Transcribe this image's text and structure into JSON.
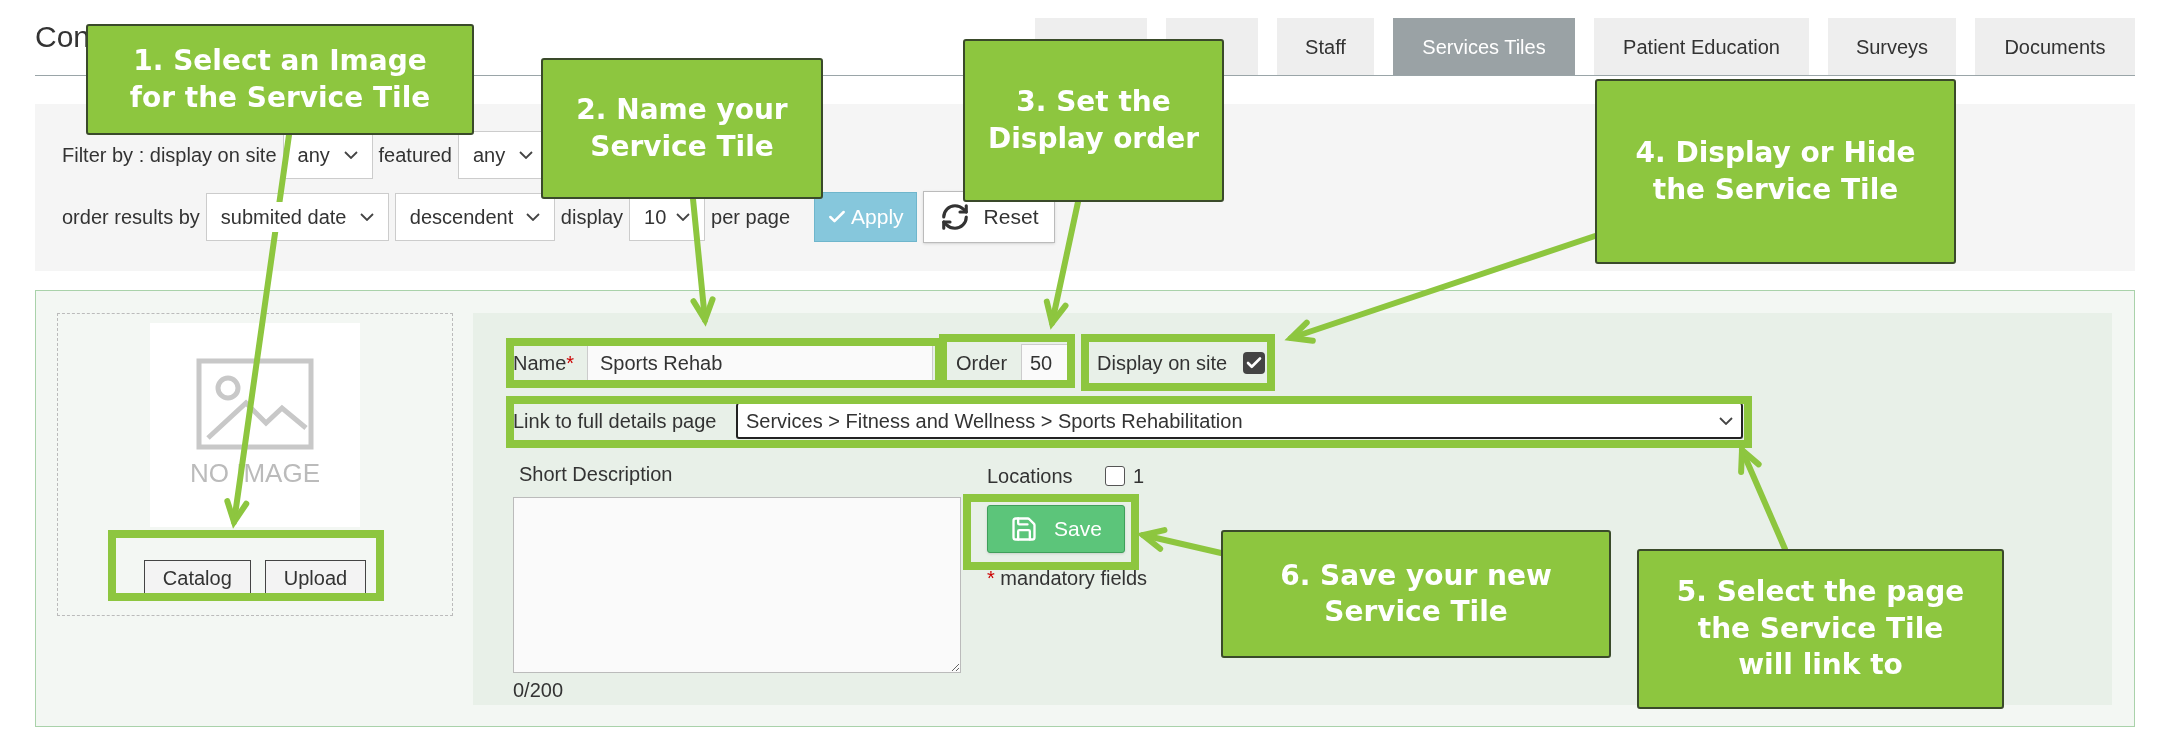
{
  "header": {
    "title": "Con",
    "tabs": [
      {
        "selected": false
      },
      {
        "selected": false
      },
      {
        "label": "Staff",
        "selected": false
      },
      {
        "label": "Services Tiles",
        "selected": true
      },
      {
        "label": "Patient Education",
        "selected": false
      },
      {
        "label": "Surveys",
        "selected": false
      },
      {
        "label": "Documents",
        "selected": false
      }
    ]
  },
  "filter": {
    "filter_line": [
      {
        "kind": "label",
        "text": "Filter by : display on site"
      },
      {
        "kind": "select",
        "text": "any"
      },
      {
        "kind": "label",
        "text": "featured"
      },
      {
        "kind": "select",
        "text": "any"
      }
    ],
    "order_line": [
      {
        "kind": "label",
        "text": "order results by"
      },
      {
        "kind": "select",
        "text": "submited date"
      },
      {
        "kind": "select",
        "text": "descendent"
      },
      {
        "kind": "label",
        "text": "display"
      },
      {
        "kind": "select",
        "text": "10"
      },
      {
        "kind": "label",
        "text": "per page"
      },
      {
        "kind": "primary-button",
        "text": "Apply"
      },
      {
        "kind": "button",
        "text": "Reset"
      }
    ]
  },
  "image_panel": {
    "placeholder": "NO IMAGE",
    "buttons": [
      "Catalog",
      "Upload"
    ]
  },
  "form": {
    "name_label": "Name",
    "name_required_mark": "*",
    "name_value": "Sports Rehab",
    "order_label": "Order",
    "order_value": "50",
    "display_label": "Display on site",
    "display_checked": true,
    "link_label": "Link to full details page",
    "link_value": "Services > Fitness and Wellness > Sports Rehabilitation",
    "description_label": "Short Description",
    "description_count": "0/200",
    "locations_label": "Locations",
    "locations": [
      {
        "label": "1",
        "checked": false
      }
    ],
    "save_button": "Save",
    "mandatory_mark": "*",
    "mandatory_note": "mandatory fields"
  },
  "callouts": [
    {
      "text": "1. Select an Image for the Service Tile"
    },
    {
      "text": "2. Name your Service Tile"
    },
    {
      "text": "3. Set the Display order"
    },
    {
      "text": "4. Display or Hide the Service Tile"
    },
    {
      "text": "5. Select the page the Service Tile will link to"
    },
    {
      "text": "6. Save your new Service Tile"
    }
  ]
}
